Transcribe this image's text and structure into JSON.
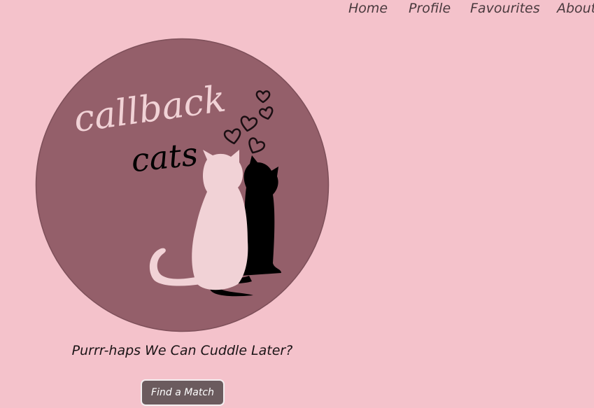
{
  "nav": {
    "items": [
      {
        "label": "Home"
      },
      {
        "label": "Profile"
      },
      {
        "label": "Favourites"
      },
      {
        "label": "About"
      }
    ]
  },
  "logo": {
    "text_line1": "callback",
    "text_line2": "cats",
    "icon": "two-cats-with-hearts-logo"
  },
  "hero": {
    "tagline": "Purrr-haps We Can Cuddle Later?",
    "button_label": "Find a Match"
  },
  "colors": {
    "page_background": "#f4c2cb",
    "logo_circle": "#945f6a",
    "light_cat": "#f1d2d6",
    "dark_cat": "#000000",
    "button_background": "#6b5b5e"
  }
}
